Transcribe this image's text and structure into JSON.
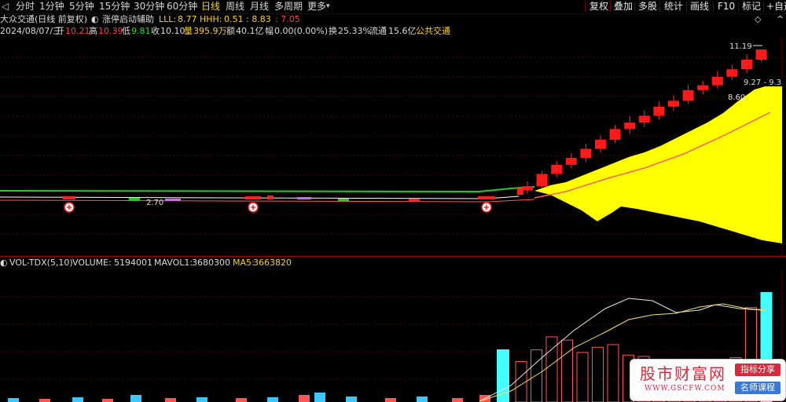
{
  "toolbar": {
    "back_glyph": "◁",
    "timeframes": [
      "分时",
      "1分钟",
      "5分钟",
      "15分钟",
      "30分钟",
      "60分钟",
      "日线",
      "周线",
      "月线",
      "多周期",
      "更多"
    ],
    "more_arrow": "▾",
    "active_timeframe": "日线",
    "right_buttons": [
      "复权",
      "叠加",
      "多股",
      "统计",
      "画线",
      "F10",
      "标记",
      "+自选"
    ]
  },
  "info_line1": {
    "title": "大众交通(日线 前复权)",
    "indicator_icon": "◐",
    "indicator_name": "涨停启动辅助",
    "lll_label": "LLL:",
    "lll_value": "8.77",
    "hhh_label": "HHH:",
    "hhh_value": "0.51",
    "v3": ": 8.83",
    "v4": ": 7.05",
    "diamond": "◇",
    "up_glyph": "^"
  },
  "info_line2": {
    "date": "2024/08/07/三",
    "open_label": "开",
    "open": "10.21",
    "high_label": "高",
    "high": "10.39",
    "low_label": "低",
    "low": "9.81",
    "close_label": "收",
    "close": "10.10",
    "vol_label": "量",
    "vol": "395.9万",
    "amount_label": "额",
    "amount": "40.1亿",
    "change_label": "幅",
    "change": "0.00(0.00%)",
    "turnover_label": "换",
    "turnover": "25.33%",
    "float_label": "流通",
    "float": "15.6亿",
    "sector": "公共交通"
  },
  "chart_labels": {
    "high_price": "11.19",
    "range": "9.27 - 9.3",
    "level": "8.60",
    "mid_value": "2.70"
  },
  "volume_header": {
    "icon": "◐",
    "name": "VOL-TDX(5,10)",
    "volume_label": "VOLUME:",
    "volume": "5194001",
    "mavol1_label": "MAVOL1:",
    "mavol1": "3680300",
    "ma5_label": "MA5:",
    "ma5": "3663820"
  },
  "watermark": {
    "title": "股市财富网",
    "url": "WWW.GSCFW.COM",
    "btn1": "指标分享",
    "btn2": "名师课程"
  },
  "colors": {
    "background": "#000000",
    "up_candle": "#ff1a1a",
    "yellow_band": "#ffff00",
    "green_line": "#22cc22",
    "volume_up": "#ff5555",
    "volume_cyan": "#44ffff",
    "grid": "#5a0000"
  },
  "chart_data": {
    "type": "candlestick",
    "candles": [
      {
        "o": 8.55,
        "c": 8.63,
        "h": 8.72,
        "l": 8.49
      },
      {
        "o": 8.63,
        "c": 8.86,
        "h": 8.92,
        "l": 8.6
      },
      {
        "o": 8.86,
        "c": 9.03,
        "h": 9.1,
        "l": 8.8
      },
      {
        "o": 9.03,
        "c": 9.16,
        "h": 9.25,
        "l": 8.96
      },
      {
        "o": 9.16,
        "c": 9.33,
        "h": 9.42,
        "l": 9.08
      },
      {
        "o": 9.33,
        "c": 9.5,
        "h": 9.58,
        "l": 9.26
      },
      {
        "o": 9.5,
        "c": 9.7,
        "h": 9.78,
        "l": 9.45
      },
      {
        "o": 9.7,
        "c": 9.82,
        "h": 9.94,
        "l": 9.61
      },
      {
        "o": 9.82,
        "c": 9.95,
        "h": 10.05,
        "l": 9.74
      },
      {
        "o": 9.95,
        "c": 10.12,
        "h": 10.22,
        "l": 9.88
      },
      {
        "o": 10.12,
        "c": 10.23,
        "h": 10.33,
        "l": 10.04
      },
      {
        "o": 10.23,
        "c": 10.43,
        "h": 10.53,
        "l": 10.17
      },
      {
        "o": 10.43,
        "c": 10.52,
        "h": 10.6,
        "l": 10.35
      },
      {
        "o": 10.52,
        "c": 10.68,
        "h": 10.79,
        "l": 10.46
      },
      {
        "o": 10.68,
        "c": 10.82,
        "h": 10.91,
        "l": 10.62
      },
      {
        "o": 10.82,
        "c": 11.0,
        "h": 11.1,
        "l": 10.75
      },
      {
        "o": 11.0,
        "c": 11.19,
        "h": 11.19,
        "l": 10.97
      }
    ],
    "volume_bars": [
      62,
      80,
      100,
      95,
      76,
      84,
      88,
      72,
      70,
      58,
      40,
      24,
      44,
      52,
      68,
      145,
      168
    ]
  }
}
